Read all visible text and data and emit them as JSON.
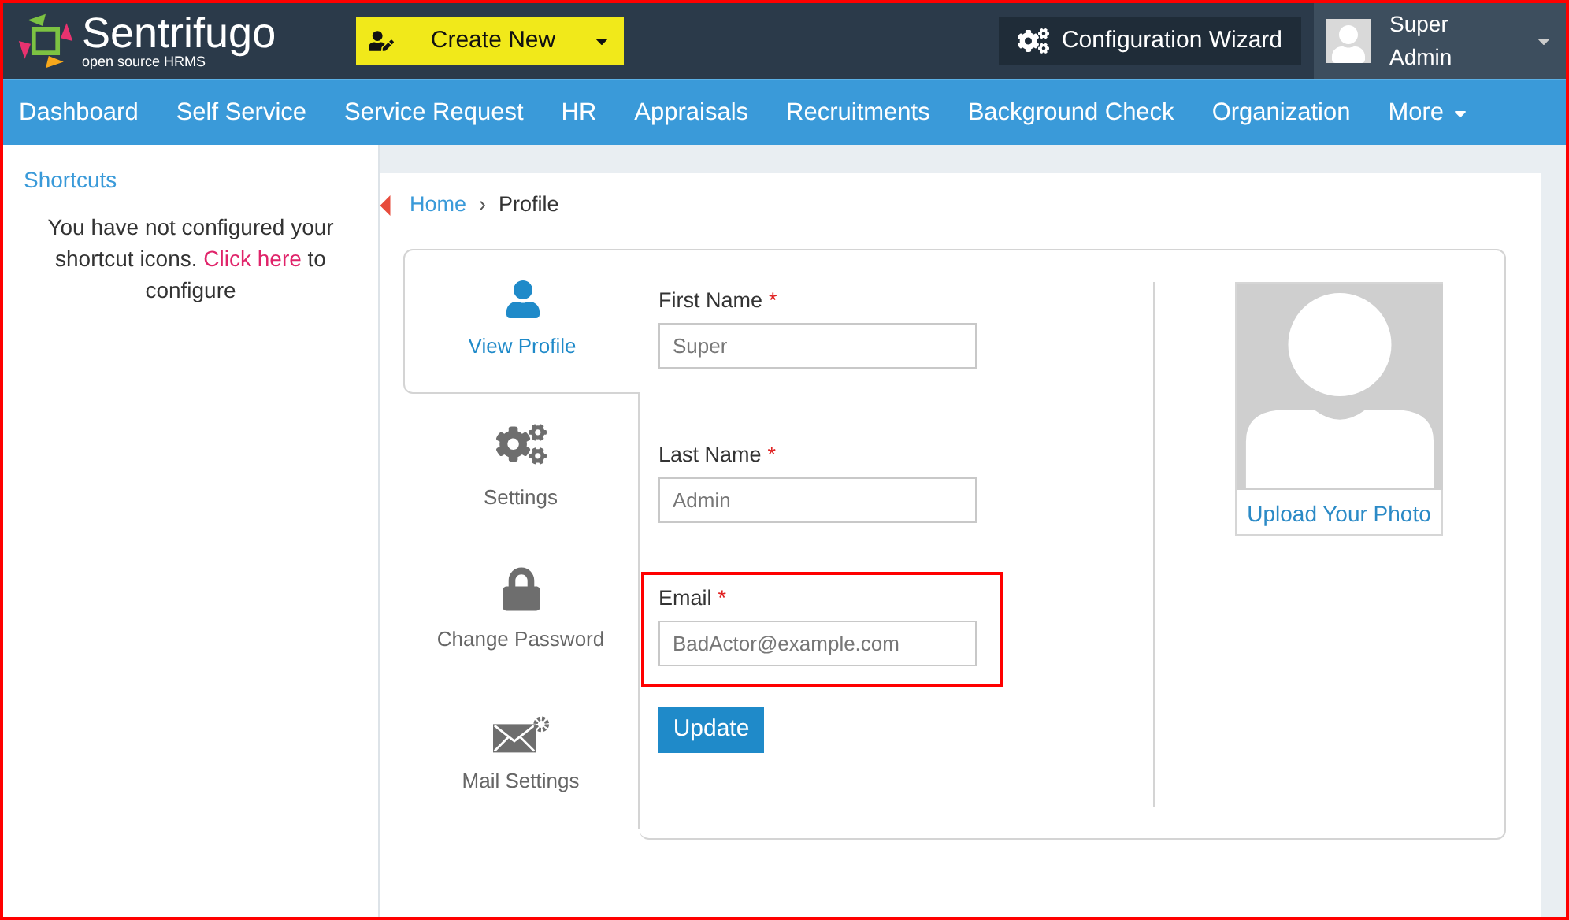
{
  "header": {
    "logo_name": "Sentrifugo",
    "logo_tagline": "open source HRMS",
    "create_button": "Create New",
    "wizard_button": "Configuration Wizard",
    "user_name": "Super Admin"
  },
  "nav": {
    "items": [
      "Dashboard",
      "Self Service",
      "Service Request",
      "HR",
      "Appraisals",
      "Recruitments",
      "Background Check",
      "Organization"
    ],
    "more": "More"
  },
  "sidebar": {
    "title": "Shortcuts",
    "message_before": "You have not configured your shortcut icons.",
    "link": "Click here",
    "message_after": "to configure"
  },
  "breadcrumb": {
    "home": "Home",
    "separator": "›",
    "current": "Profile"
  },
  "tabs": [
    {
      "kind": "profile",
      "label": "View Profile",
      "selected": true
    },
    {
      "kind": "settings",
      "label": "Settings",
      "selected": false
    },
    {
      "kind": "password",
      "label": "Change Password",
      "selected": false
    },
    {
      "kind": "mail",
      "label": "Mail Settings",
      "selected": false
    }
  ],
  "fields": [
    {
      "label": "First Name",
      "required_mark": "*",
      "value": "Super",
      "highlighted": false
    },
    {
      "label": "Last Name",
      "required_mark": "*",
      "value": "Admin",
      "highlighted": false
    },
    {
      "label": "Email",
      "required_mark": "*",
      "value": "BadActor@example.com",
      "highlighted": true
    }
  ],
  "update_button": "Update",
  "photo": {
    "link": "Upload Your Photo"
  }
}
